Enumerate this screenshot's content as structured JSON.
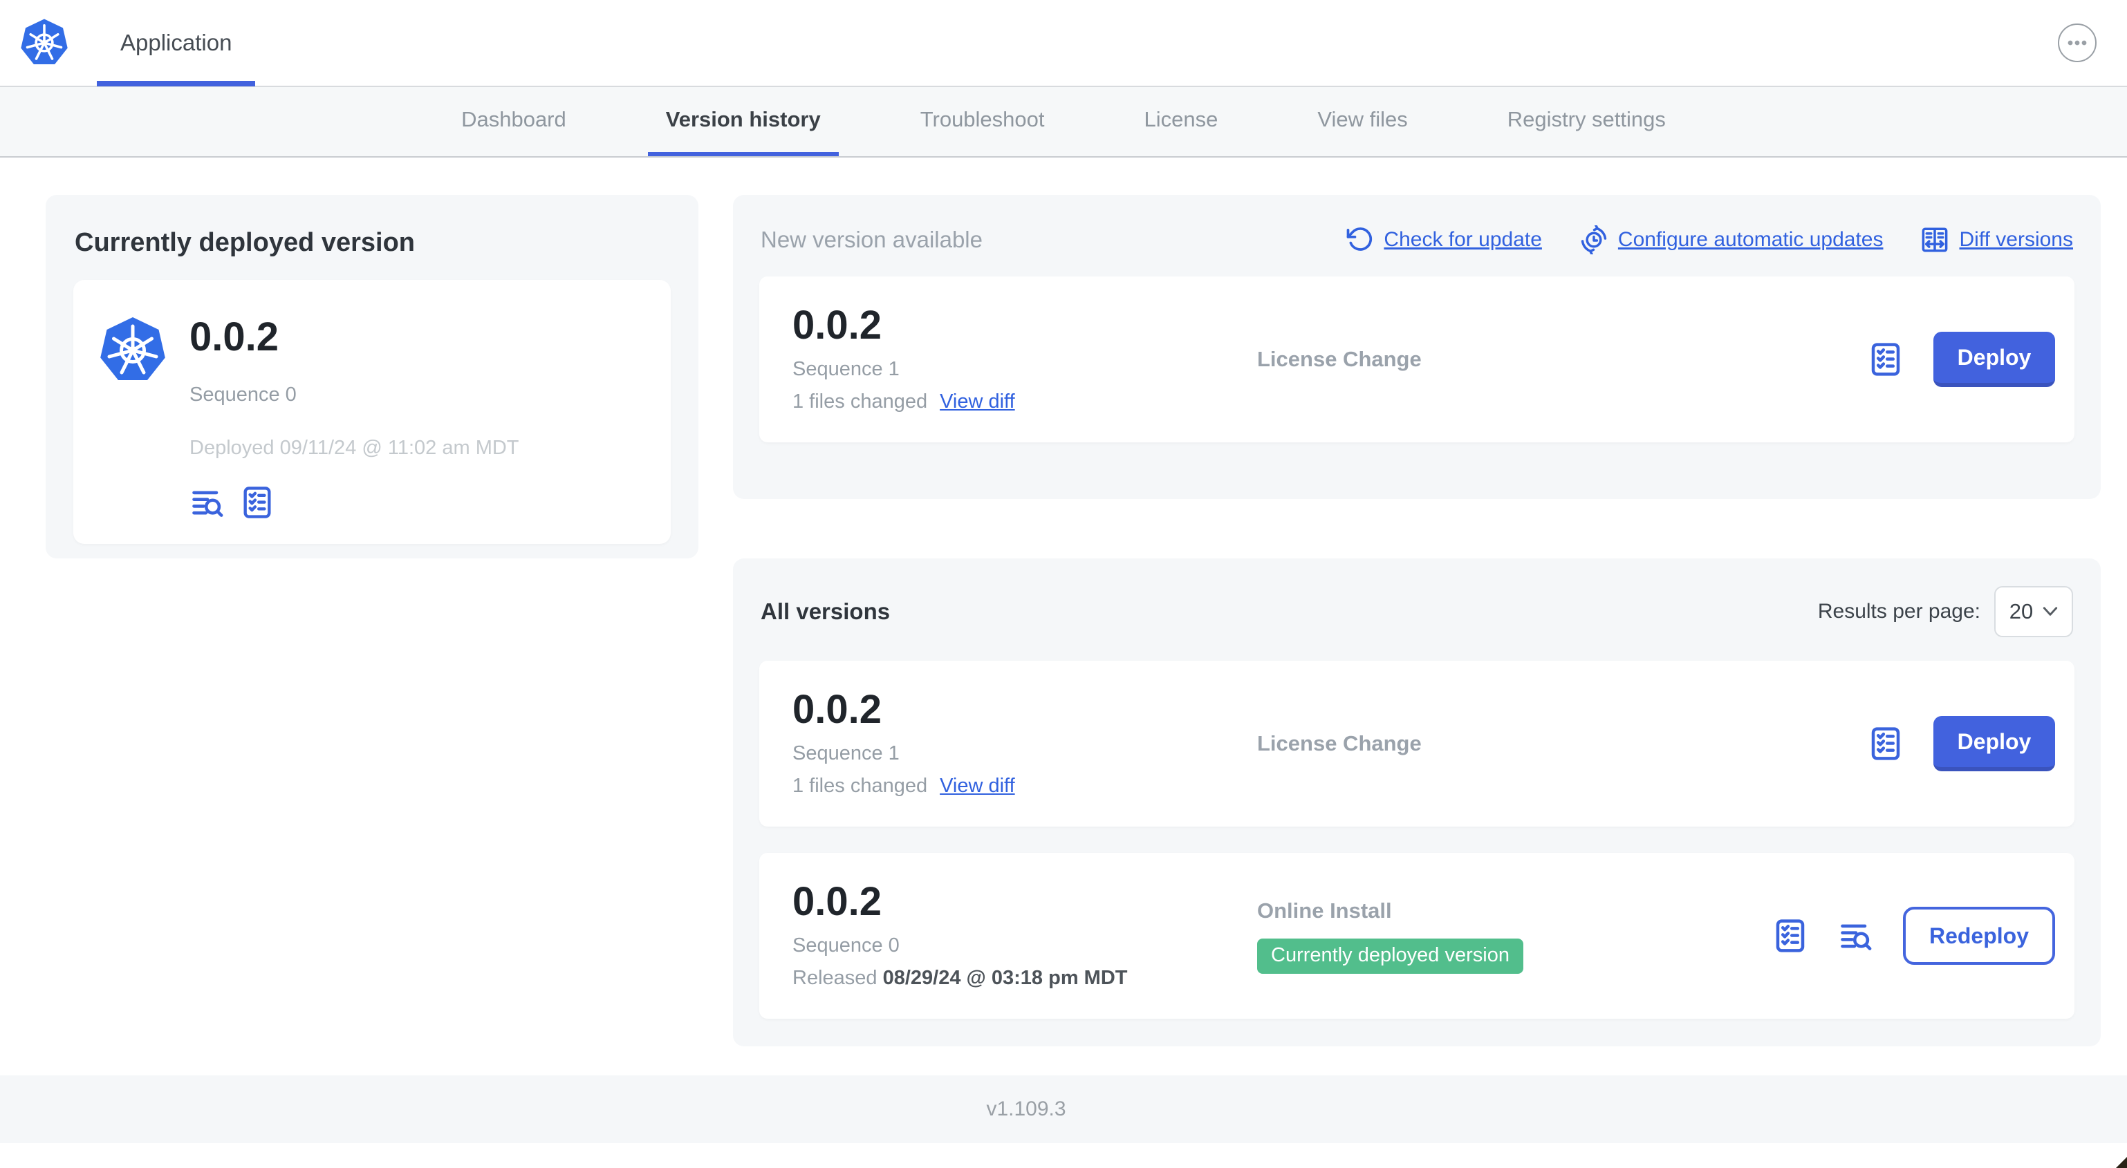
{
  "header": {
    "app_tab": "Application"
  },
  "nav": {
    "tabs": [
      "Dashboard",
      "Version history",
      "Troubleshoot",
      "License",
      "View files",
      "Registry settings"
    ],
    "active_tab": "Version history"
  },
  "current_deployed": {
    "title": "Currently deployed version",
    "version": "0.0.2",
    "sequence": "Sequence 0",
    "deployed": "Deployed 09/11/24 @ 11:02 am MDT"
  },
  "new_version": {
    "title": "New version available",
    "actions": [
      {
        "label": "Check for update",
        "icon": "refresh-icon"
      },
      {
        "label": "Configure automatic updates",
        "icon": "schedule-icon"
      },
      {
        "label": "Diff versions",
        "icon": "diff-icon"
      }
    ],
    "row": {
      "version": "0.0.2",
      "sequence": "Sequence 1",
      "files_changed": "1 files changed",
      "view_diff": "View diff",
      "source": "License Change",
      "action": "Deploy"
    }
  },
  "all_versions": {
    "title": "All versions",
    "results_per_page_label": "Results per page:",
    "results_per_page_value": "20",
    "rows": [
      {
        "version": "0.0.2",
        "sequence": "Sequence 1",
        "files_changed": "1 files changed",
        "view_diff": "View diff",
        "source": "License Change",
        "action": "Deploy"
      },
      {
        "version": "0.0.2",
        "sequence": "Sequence 0",
        "released_label": "Released",
        "released_date": "08/29/24 @ 03:18 pm MDT",
        "source": "Online Install",
        "badge": "Currently deployed version",
        "action": "Redeploy"
      }
    ]
  },
  "footer": {
    "version": "v1.109.3"
  },
  "colors": {
    "accent_blue": "#4262de",
    "link_blue": "#3161df",
    "badge_green": "#52be8c",
    "kubernetes_blue": "#326de6",
    "card_gray": "#f5f7f9"
  }
}
